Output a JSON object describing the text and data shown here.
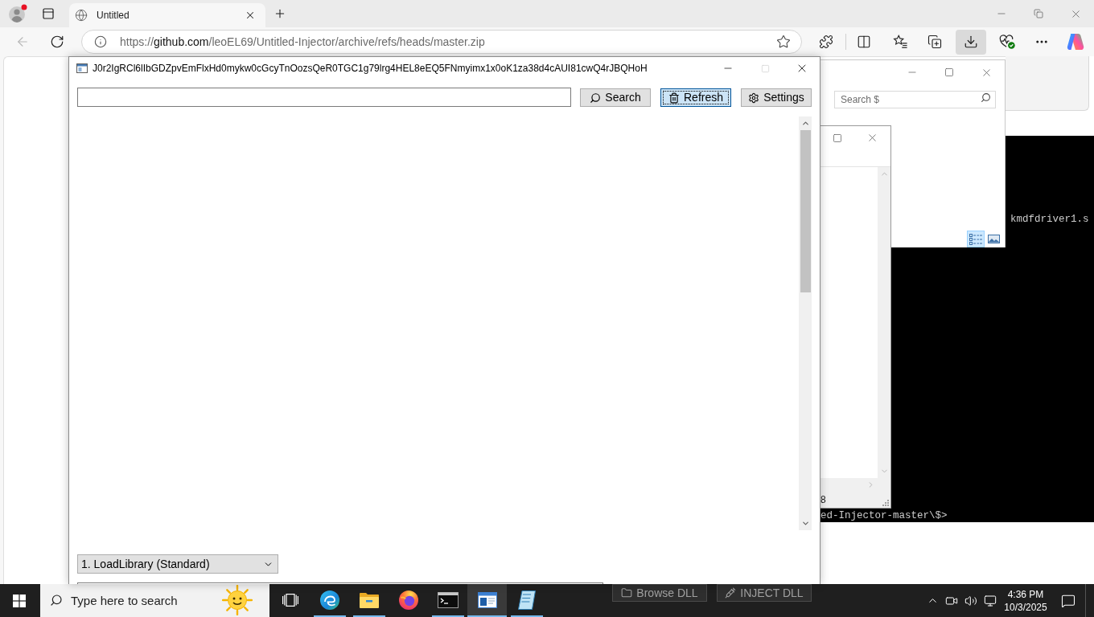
{
  "browser": {
    "tabs": [
      {
        "title": "Untitled",
        "selected": true
      }
    ],
    "address": {
      "scheme": "https://",
      "domain": "github.com",
      "path": "/leoEL69/Untitled-Injector/archive/refs/heads/master.zip"
    },
    "downloads_active": true
  },
  "injector_window": {
    "title": "J0r2IgRCl6lIbGDZpvEmFlxHd0mykw0cGcyTnOozsQeR0TGC1g79lrg4HEL8eEQ5FNmyimx1x0oK1za38d4cAUI81cwQ4rJBQHoH",
    "maximize_disabled": true,
    "buttons": [
      {
        "kind": "search",
        "label": "Search",
        "focused": false
      },
      {
        "kind": "refresh",
        "label": "Refresh",
        "focused": true
      },
      {
        "kind": "settings",
        "label": "Settings",
        "focused": false
      }
    ],
    "method": "1. LoadLibrary (Standard)",
    "bottom_buttons": [
      {
        "kind": "browse",
        "label": "Browse DLL"
      },
      {
        "kind": "inject",
        "label": "INJECT DLL"
      }
    ]
  },
  "explorer_window": {
    "search_placeholder": "Search $",
    "views": [
      {
        "kind": "details",
        "selected": true
      },
      {
        "kind": "preview",
        "selected": false
      }
    ]
  },
  "small_window": {
    "status": "8"
  },
  "console": {
    "output": "kmdfdriver1.s",
    "prompt": "ed-Injector-master\\$>"
  },
  "taskbar": {
    "search_placeholder": "Type here to search",
    "apps": [
      {
        "kind": "taskview",
        "active": false,
        "running": false
      },
      {
        "kind": "swirl",
        "active": false,
        "running": true
      },
      {
        "kind": "folder",
        "active": false,
        "running": true
      },
      {
        "kind": "fox",
        "active": false,
        "running": false
      },
      {
        "kind": "terminal",
        "active": false,
        "running": true
      },
      {
        "kind": "window",
        "active": true,
        "running": true
      },
      {
        "kind": "notebook",
        "active": false,
        "running": true
      }
    ],
    "time": "4:36 PM",
    "date": "10/3/2025"
  }
}
